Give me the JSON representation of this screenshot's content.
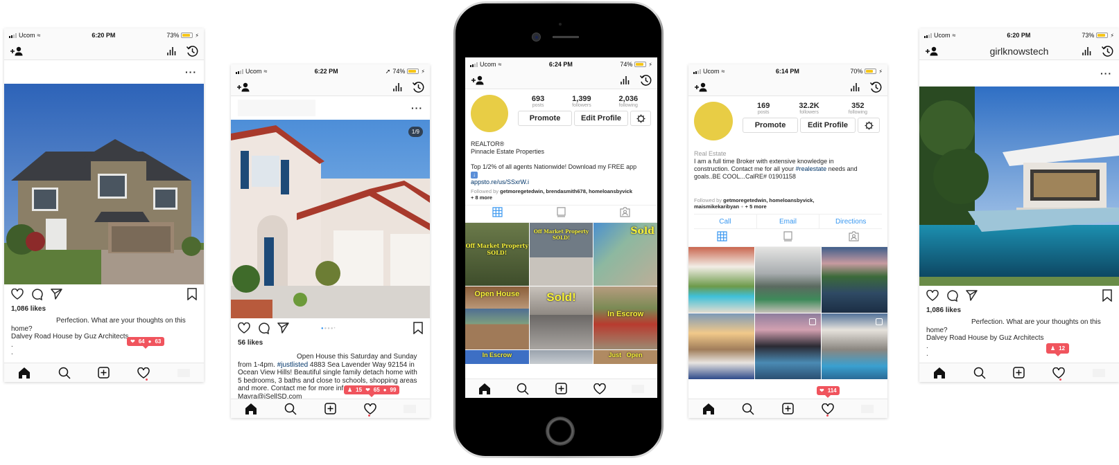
{
  "status_common": {
    "carrier": "Ucom"
  },
  "phones": [
    {
      "time": "6:20 PM",
      "battery": "73%",
      "battery_level": 0.73,
      "post": {
        "likes": "1,086 likes",
        "caption_line1": "Perfection. What are your thoughts on this",
        "caption_line2": "home?",
        "caption_line3": "Dalvey Road House by Guz Architects",
        "caption_dots": [
          ".",
          "."
        ]
      },
      "notification": {
        "likes": "64",
        "comments": "63"
      }
    },
    {
      "time": "6:22 PM",
      "battery": "74%",
      "battery_level": 0.74,
      "post": {
        "carousel_counter": "1/9",
        "likes": "56 likes",
        "caption_line1": "Open House this Saturday and Sunday",
        "caption_line2_pre": "from 1-4pm. ",
        "caption_hashtag": "#justlisted",
        "caption_line2_post": " 4883 Sea Lavender Way 92154 in",
        "caption_line3": "Ocean View Hills! Beautiful single family detach home with",
        "caption_line4": "5 bedrooms, 3 baths and close to schools, shopping areas",
        "caption_line5": "and more. Contact me for more inf",
        "caption_line6": "Mayra@iSellSD.com"
      },
      "notification": {
        "followers": "15",
        "likes": "65",
        "comments": "99"
      }
    },
    {
      "time": "6:24 PM",
      "battery": "74%",
      "battery_level": 0.74,
      "profile": {
        "posts": "693",
        "posts_label": "posts",
        "followers": "1,399",
        "followers_label": "followers",
        "following": "2,036",
        "following_label": "following",
        "promote": "Promote",
        "edit_profile": "Edit Profile",
        "bio_line1": "REALTOR®",
        "bio_line2": "Pinnacle Estate Properties",
        "bio_line3": "Top 1/2% of all agents Nationwide! Download my FREE app",
        "link": "appsto.re/us/SSxrW.i",
        "followed_by_label": "Followed by",
        "followed_by": "getmoregetedwin, brendasmith678, homeloansbyvick",
        "followed_more": "+ 8 more",
        "grid_overlays": [
          "Off Market Property SOLD!",
          "Off Market Property SOLD!",
          "Sold",
          "Open House",
          "Sold!",
          "In Escrow",
          "In Escrow",
          "Just",
          "Open"
        ]
      }
    },
    {
      "time": "6:14 PM",
      "battery": "70%",
      "battery_level": 0.7,
      "profile": {
        "posts": "169",
        "posts_label": "posts",
        "followers": "32.2K",
        "followers_label": "followers",
        "following": "352",
        "following_label": "following",
        "promote": "Promote",
        "edit_profile": "Edit Profile",
        "category": "Real Estate",
        "bio_line1": "I am a full time Broker with extensive knowledge in",
        "bio_line2_pre": "construction. Contact me for all your ",
        "bio_hashtag": "#realestate",
        "bio_line2_post": " needs and",
        "bio_line3": "goals..BE COOL...CalRE# 01901158",
        "followed_by_label": "Followed by",
        "followed_by": "getmoregetedwin, homeloansbyvick,",
        "followed_by2": "maismikekaribyan",
        "followed_more": "+ 5 more",
        "contact": [
          "Call",
          "Email",
          "Directions"
        ]
      },
      "notification": {
        "likes": "114"
      }
    },
    {
      "time": "6:20 PM",
      "battery": "73%",
      "battery_level": 0.73,
      "username": "girlknowstech",
      "post": {
        "likes": "1,086 likes",
        "caption_line1": "Perfection. What are your thoughts on this",
        "caption_line2": "home?",
        "caption_line3": "Dalvey Road House by Guz Architects",
        "caption_dots": [
          ".",
          "."
        ]
      },
      "notification": {
        "followers": "12"
      }
    }
  ],
  "colors": {
    "notification": "#f0545d",
    "link": "#3897f0",
    "avatar": "#e8cd45",
    "hashtag": "#003569"
  }
}
